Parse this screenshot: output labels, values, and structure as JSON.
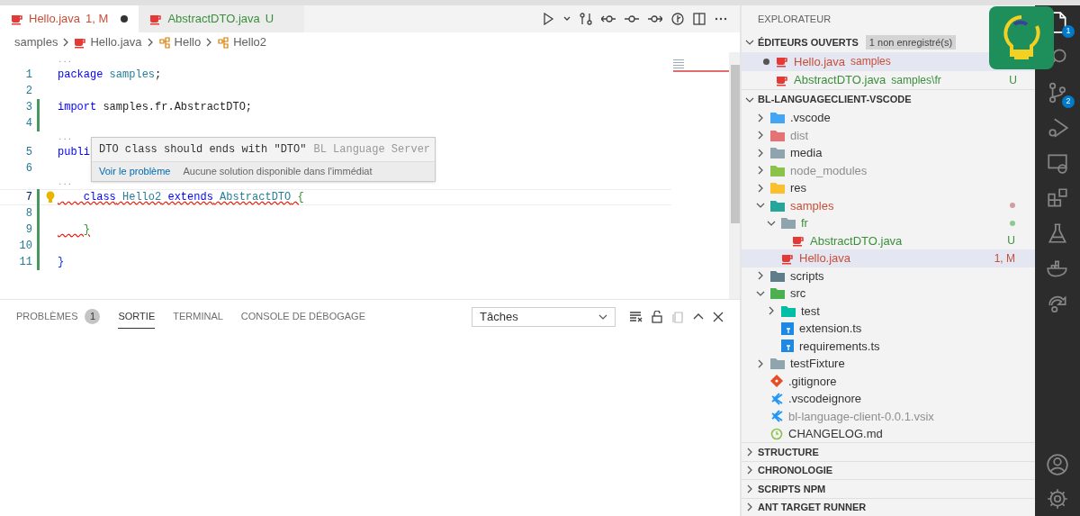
{
  "tabs": [
    {
      "label": "Hello.java",
      "badge": "1, M",
      "color": "#c74e39",
      "dirty": true,
      "selected": true
    },
    {
      "label": "AbstractDTO.java",
      "badge": "U",
      "color": "#3b8e3b",
      "dirty": false,
      "selected": false
    }
  ],
  "breadcrumbs": [
    {
      "kind": "folder",
      "label": "samples"
    },
    {
      "kind": "java",
      "label": "Hello.java"
    },
    {
      "kind": "class",
      "label": "Hello"
    },
    {
      "kind": "class",
      "label": "Hello2"
    }
  ],
  "code": [
    {
      "kind": "fold",
      "text": "..."
    },
    {
      "kind": "line",
      "number": "1",
      "modified": false,
      "tokens": [
        {
          "kind": "keyword",
          "text": "package"
        },
        {
          "kind": "type",
          "text": " samples"
        },
        {
          "kind": "plain",
          "text": ";"
        }
      ]
    },
    {
      "kind": "line",
      "number": "2",
      "modified": false
    },
    {
      "kind": "line",
      "number": "3",
      "modified": true,
      "tokens": [
        {
          "kind": "keyword",
          "text": "import"
        },
        {
          "kind": "plain",
          "text": " samples.fr.AbstractDTO;"
        }
      ]
    },
    {
      "kind": "line",
      "number": "4",
      "modified": true
    },
    {
      "kind": "fold",
      "text": "..."
    },
    {
      "kind": "line",
      "number": "5",
      "modified": false,
      "tokens": [
        {
          "kind": "keyword",
          "text": "publi"
        }
      ]
    },
    {
      "kind": "line",
      "number": "6",
      "modified": false
    },
    {
      "kind": "fold",
      "text": "..."
    },
    {
      "kind": "line",
      "number": "7",
      "modified": true,
      "current": true,
      "lightbulb": true,
      "tokens": [
        {
          "kind": "keyword",
          "text": "    class",
          "error": true
        },
        {
          "kind": "type",
          "text": " Hello2",
          "error": true
        },
        {
          "kind": "keyword",
          "text": " extends",
          "error": true
        },
        {
          "kind": "type",
          "text": " AbstractDTO",
          "error": true
        },
        {
          "kind": "bracket1",
          "text": " {",
          "error": true
        }
      ]
    },
    {
      "kind": "line",
      "number": "8",
      "modified": true
    },
    {
      "kind": "line",
      "number": "9",
      "modified": true,
      "tokens": [
        {
          "kind": "bracket1",
          "text": "    }",
          "error": true
        }
      ]
    },
    {
      "kind": "line",
      "number": "10",
      "modified": true
    },
    {
      "kind": "line",
      "number": "11",
      "modified": true,
      "tokens": [
        {
          "kind": "bracket2",
          "text": "}"
        }
      ]
    }
  ],
  "hover": {
    "message": "DTO class should ends with \"DTO\"",
    "source": "BL Language Server",
    "action": "Voir le problème",
    "note": "Aucune solution disponible dans l'immédiat"
  },
  "panel": {
    "tabs": [
      {
        "label": "PROBLÈMES",
        "badge": "1",
        "selected": false
      },
      {
        "label": "SORTIE",
        "selected": true
      },
      {
        "label": "TERMINAL",
        "selected": false
      },
      {
        "label": "CONSOLE DE DÉBOGAGE",
        "selected": false
      }
    ],
    "dropdown": "Tâches"
  },
  "explorer": {
    "title": "EXPLORATEUR",
    "open_editors": {
      "title": "ÉDITEURS OUVERTS",
      "badge": "1 non enregistré(s)",
      "expanded": true,
      "items": [
        {
          "name": "Hello.java",
          "path": "samples",
          "color": "#c74e39",
          "dirty": true,
          "selected": true
        },
        {
          "name": "AbstractDTO.java",
          "path": "samples\\fr",
          "color": "#3b8e3b",
          "decoration": "U",
          "dirty": false,
          "selected": false
        }
      ]
    },
    "workspace": {
      "title": "BL-LANGUAGECLIENT-VSCODE",
      "expanded": true,
      "items": [
        {
          "name": ".vscode",
          "kind": "folder",
          "color": "#42a5f5",
          "expanded": false,
          "selected": false
        },
        {
          "name": "dist",
          "kind": "folder",
          "color": "#e57373",
          "ignored": true,
          "expanded": false,
          "selected": false
        },
        {
          "name": "media",
          "kind": "folder",
          "color": "#90a4ae",
          "expanded": false,
          "selected": false
        },
        {
          "name": "node_modules",
          "kind": "folder",
          "color": "#8bc34a",
          "ignored": true,
          "expanded": false,
          "selected": false
        },
        {
          "name": "res",
          "kind": "folder",
          "color": "#fbc02d",
          "expanded": false,
          "selected": false
        },
        {
          "name": "samples",
          "kind": "folder",
          "color": "#26a69a",
          "modified": true,
          "expanded": true,
          "selected": false,
          "children": [
            {
              "name": "fr",
              "kind": "folder",
              "color": "#90a4ae",
              "untracked": true,
              "expanded": true,
              "selected": false,
              "children": [
                {
                  "name": "AbstractDTO.java",
                  "kind": "java",
                  "untracked": true,
                  "decoration": "U",
                  "selected": false
                }
              ]
            },
            {
              "name": "Hello.java",
              "kind": "java",
              "modified": true,
              "decoration": "1, M",
              "selected": true
            }
          ]
        },
        {
          "name": "scripts",
          "kind": "folder",
          "color": "#607d8b",
          "expanded": false,
          "selected": false
        },
        {
          "name": "src",
          "kind": "folder",
          "color": "#4caf50",
          "expanded": true,
          "selected": false,
          "children": [
            {
              "name": "test",
              "kind": "folder",
              "color": "#00bfa5",
              "expanded": false,
              "selected": false
            },
            {
              "name": "extension.ts",
              "kind": "typescript",
              "selected": false
            },
            {
              "name": "requirements.ts",
              "kind": "typescript",
              "selected": false
            }
          ]
        },
        {
          "name": "testFixture",
          "kind": "folder",
          "color": "#90a4ae",
          "expanded": false,
          "selected": false
        },
        {
          "name": ".gitignore",
          "kind": "git",
          "selected": false
        },
        {
          "name": ".vscodeignore",
          "kind": "vscode",
          "selected": false
        },
        {
          "name": "bl-language-client-0.0.1.vsix",
          "kind": "vscode",
          "ignored": true,
          "selected": false
        },
        {
          "name": "CHANGELOG.md",
          "kind": "changelog",
          "selected": false
        }
      ]
    },
    "sections": [
      {
        "title": "STRUCTURE",
        "expanded": false
      },
      {
        "title": "CHRONOLOGIE",
        "expanded": false
      },
      {
        "title": "SCRIPTS NPM",
        "expanded": false
      },
      {
        "title": "ANT TARGET RUNNER",
        "expanded": false
      }
    ]
  },
  "activity_bar": [
    {
      "kind": "files",
      "badge": "1",
      "selected": true
    },
    {
      "kind": "search",
      "selected": false
    },
    {
      "kind": "source-control",
      "badge": "2",
      "selected": false
    },
    {
      "kind": "run-debug",
      "selected": false
    },
    {
      "kind": "remote",
      "selected": false
    },
    {
      "kind": "extensions",
      "selected": false
    },
    {
      "kind": "testing",
      "selected": false
    },
    {
      "kind": "docker",
      "selected": false
    },
    {
      "kind": "share",
      "selected": false
    }
  ],
  "activity_bottom": [
    {
      "kind": "account"
    },
    {
      "kind": "settings"
    }
  ]
}
